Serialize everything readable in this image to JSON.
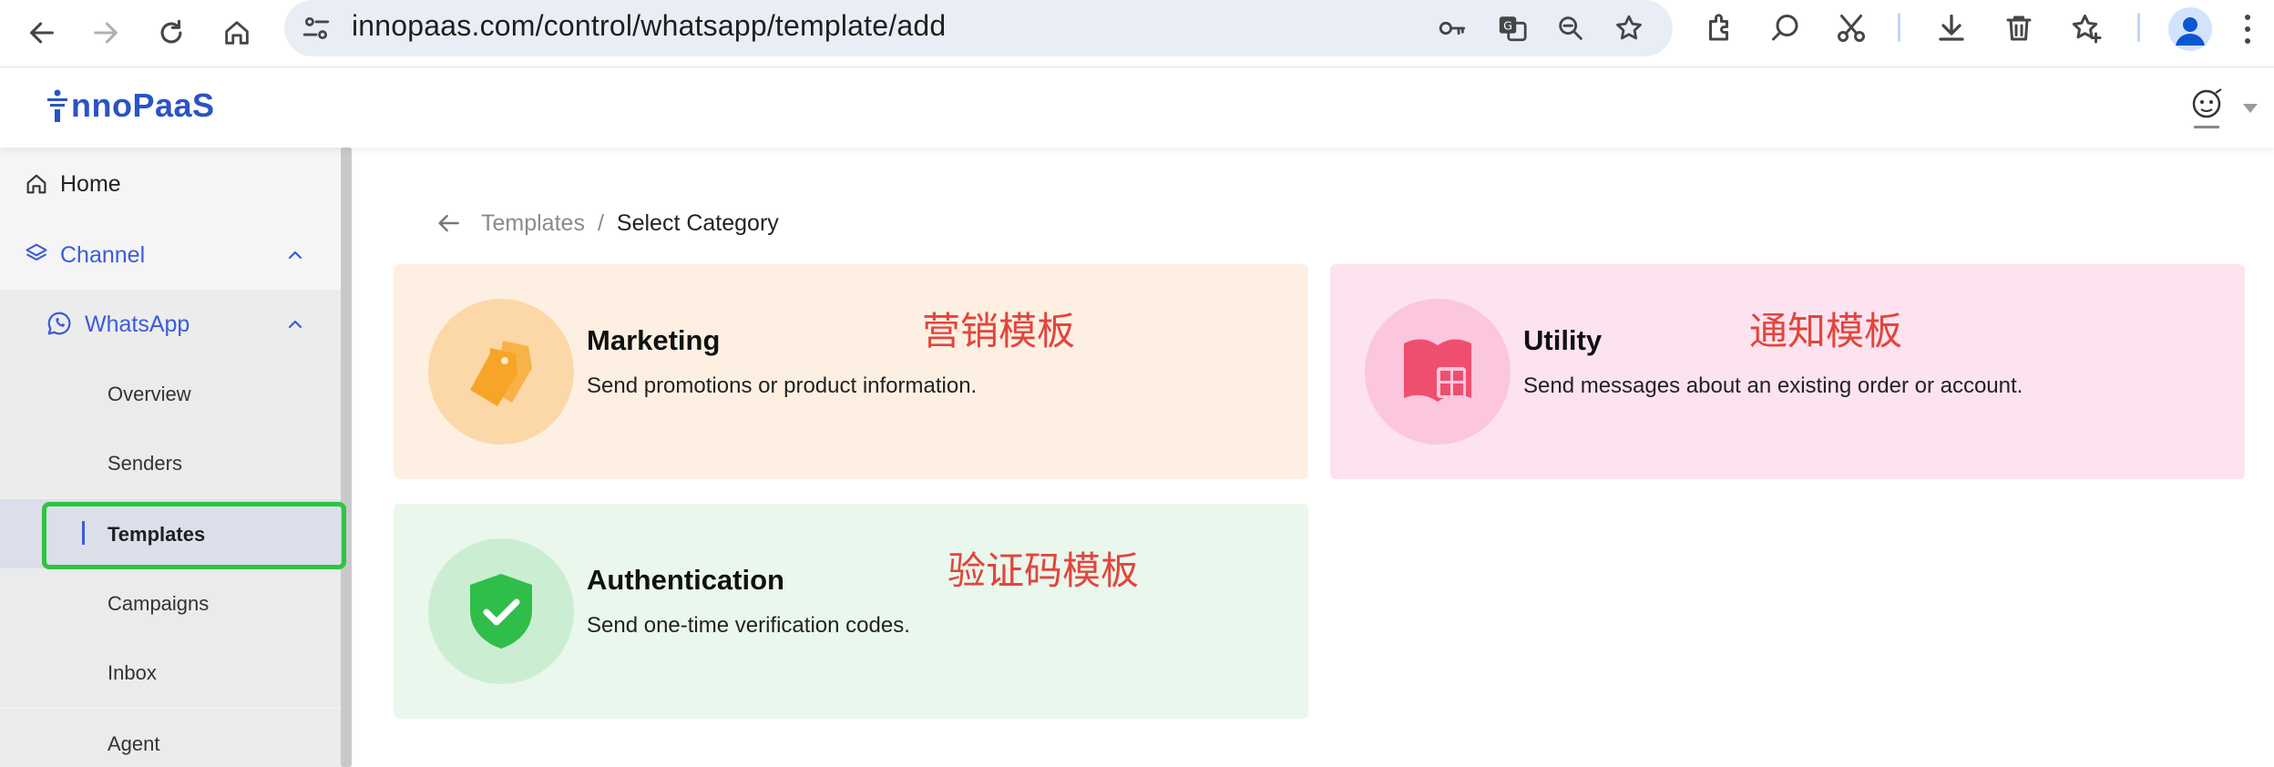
{
  "browser": {
    "url": "innopaas.com/control/whatsapp/template/add",
    "nav_icons": [
      "back-icon",
      "forward-icon",
      "reload-icon",
      "home-icon"
    ],
    "toolbar_icons": [
      "key-icon",
      "translate-icon",
      "zoom-icon",
      "star-icon",
      "extensions-icon",
      "search-lens-icon",
      "scissors-icon",
      "download-icon",
      "trash-icon",
      "reading-list-star-icon",
      "profile-icon",
      "menu-icon"
    ]
  },
  "app": {
    "logo_text": "nnoPaaS",
    "brand_color": "#2b53c6"
  },
  "sidebar": {
    "home": "Home",
    "channel": "Channel",
    "whatsapp": "WhatsApp",
    "sub_items": [
      "Overview",
      "Senders",
      "Templates",
      "Campaigns",
      "Inbox",
      "Agent"
    ],
    "selected": "Templates",
    "accent": "#3b5bdb"
  },
  "breadcrumb": {
    "link": "Templates",
    "separator": "/",
    "current": "Select Category"
  },
  "cards": {
    "marketing": {
      "title": "Marketing",
      "desc": "Send promotions or product information.",
      "annotation": "营销模板",
      "icon": "tag-icon",
      "color": "#f7a528"
    },
    "utility": {
      "title": "Utility",
      "desc": "Send messages about an existing order or account.",
      "annotation": "通知模板",
      "icon": "book-icon",
      "color": "#ef4f6e"
    },
    "authentication": {
      "title": "Authentication",
      "desc": "Send one-time verification codes.",
      "annotation": "验证码模板",
      "icon": "shield-check-icon",
      "color": "#2fbe4a"
    }
  },
  "annotation_color": "#e2453c",
  "highlight_color": "#2ec443"
}
